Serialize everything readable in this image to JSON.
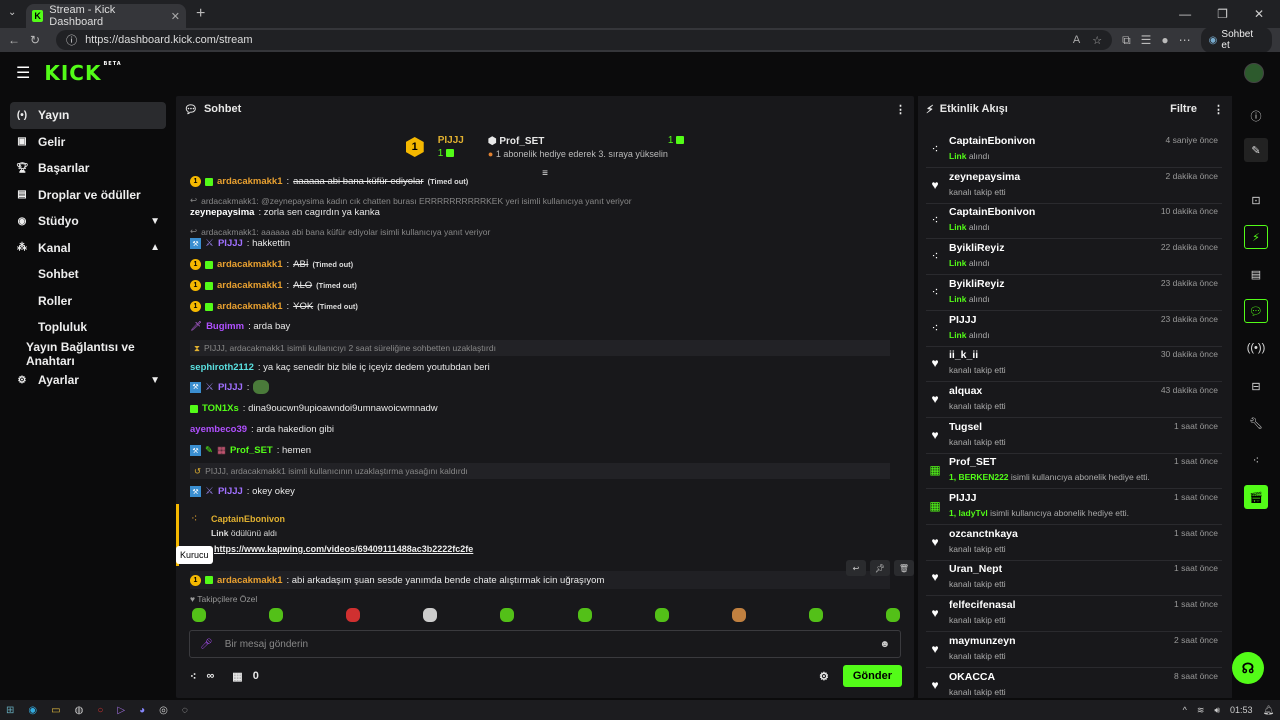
{
  "browser": {
    "tab_title": "Stream - Kick Dashboard",
    "url": "https://dashboard.kick.com/stream",
    "chat_button": "Sohbet et"
  },
  "app": {
    "logo": "KICK",
    "beta": "BETA"
  },
  "sidebar": {
    "items": [
      {
        "label": "Yayın",
        "icon": "broadcast-icon"
      },
      {
        "label": "Gelir",
        "icon": "revenue-icon"
      },
      {
        "label": "Başarılar",
        "icon": "trophy-icon"
      },
      {
        "label": "Droplar ve ödüller",
        "icon": "gift-icon"
      },
      {
        "label": "Stüdyo",
        "icon": "studio-icon"
      },
      {
        "label": "Kanal",
        "icon": "channel-icon"
      },
      {
        "label": "Sohbet"
      },
      {
        "label": "Roller"
      },
      {
        "label": "Topluluk"
      },
      {
        "label": "Yayın Bağlantısı ve Anahtarı"
      },
      {
        "label": "Ayarlar",
        "icon": "gear-icon"
      }
    ]
  },
  "chat": {
    "title": "Sohbet",
    "pinned": {
      "user1": "PIJJJ",
      "count1": "1",
      "badge": "1",
      "user2": "Prof_SET",
      "count2": "1",
      "text": "1 abonelik hediye ederek 3. sıraya yükselin"
    },
    "messages": [
      {
        "user": "ardacakmakk1",
        "text": "aaaaaa abi bana küfür ediyolar",
        "tag": "(Timed out)"
      },
      {
        "reply": "ardacakmakk1: @zeynepaysima kadın cık chatten burası ERRRRRRRRRRKEK yeri isimli kullanıcıya yanıt veriyor"
      },
      {
        "user": "zeynepaysima",
        "text": ": zorla sen cagırdın ya kanka"
      },
      {
        "reply": "ardacakmakk1: aaaaaa abi bana küfür ediyolar isimli kullanıcıya yanıt veriyor"
      },
      {
        "user": "PIJJJ",
        "text": ": hakkettin"
      },
      {
        "user": "ardacakmakk1",
        "text": "ABİ",
        "tag": "(Timed out)"
      },
      {
        "user": "ardacakmakk1",
        "text": "ALO",
        "tag": "(Timed out)"
      },
      {
        "user": "ardacakmakk1",
        "text": "YOK",
        "tag": "(Timed out)"
      },
      {
        "user": "Bugimm",
        "text": ": arda bay"
      },
      {
        "system": "PIJJJ, ardacakmakk1 isimli kullanıcıyı 2 saat süreliğine sohbetten uzaklaştırdı"
      },
      {
        "user": "sephiroth2112",
        "text": ": ya kaç senedir biz bile iç içeyiz dedem youtubdan beri"
      },
      {
        "user": "PIJJJ",
        "text": ":"
      },
      {
        "user": "TON1Xs",
        "text": ": dina9oucwn9upioawndoi9umnawoicwmnadw"
      },
      {
        "user": "ayembeco39",
        "text": ": arda hakedion gibi"
      },
      {
        "user": "Prof_SET",
        "text": ": hemen"
      },
      {
        "system": "PIJJJ, ardacakmakk1 isimli kullanıcının uzaklaştırma yasağını kaldırdı"
      },
      {
        "user": "PIJJJ",
        "text": ": okey okey"
      },
      {
        "user": "ardacakmakk1",
        "text": ": abi arkadaşım şuan sesde yanımda bende chate alıştırmak icin uğraşıyom"
      }
    ],
    "highlight": {
      "name": "CaptainEbonivon",
      "desc_bold": "Link",
      "desc": " ödülünü aldı",
      "link": "https://www.kapwing.com/videos/69409111488ac3b2222fc2fe"
    },
    "tooltip": "Kurucu",
    "followers_only": "Takipçilere Özel",
    "input_placeholder": "Bir mesaj gönderin",
    "viewers_symbol": "∞",
    "gift_count": "0",
    "send_label": "Gönder"
  },
  "feed": {
    "title": "Etkinlik Akışı",
    "filter": "Filtre",
    "items": [
      {
        "name": "CaptainEbonivon",
        "bold": "Link",
        "desc": " alındı",
        "time": "4 saniye önce",
        "icon": "reward-icon"
      },
      {
        "name": "zeynepaysima",
        "bold": "",
        "desc": "kanalı takip etti",
        "time": "2 dakika önce",
        "icon": "heart-icon"
      },
      {
        "name": "CaptainEbonivon",
        "bold": "Link",
        "desc": " alındı",
        "time": "10 dakika önce",
        "icon": "reward-icon"
      },
      {
        "name": "ByikliReyiz",
        "bold": "Link",
        "desc": " alındı",
        "time": "22 dakika önce",
        "icon": "reward-icon"
      },
      {
        "name": "ByikliReyiz",
        "bold": "Link",
        "desc": " alındı",
        "time": "23 dakika önce",
        "icon": "reward-icon"
      },
      {
        "name": "PIJJJ",
        "bold": "Link",
        "desc": " alındı",
        "time": "23 dakika önce",
        "icon": "reward-icon"
      },
      {
        "name": "ii_k_ii",
        "bold": "",
        "desc": "kanalı takip etti",
        "time": "30 dakika önce",
        "icon": "heart-icon"
      },
      {
        "name": "alquax",
        "bold": "",
        "desc": "kanalı takip etti",
        "time": "43 dakika önce",
        "icon": "heart-icon"
      },
      {
        "name": "Tugsel",
        "bold": "",
        "desc": "kanalı takip etti",
        "time": "1 saat önce",
        "icon": "heart-icon"
      },
      {
        "name": "Prof_SET",
        "bold": "1, BERKEN222",
        "desc": " isimli kullanıcıya abonelik hediye etti.",
        "time": "1 saat önce",
        "icon": "gift-sub-icon"
      },
      {
        "name": "PIJJJ",
        "bold": "1, ladyTvl",
        "desc": " isimli kullanıcıya abonelik hediye etti.",
        "time": "1 saat önce",
        "icon": "gift-sub-icon"
      },
      {
        "name": "ozcanctnkaya",
        "bold": "",
        "desc": "kanalı takip etti",
        "time": "1 saat önce",
        "icon": "heart-icon"
      },
      {
        "name": "Uran_Nept",
        "bold": "",
        "desc": "kanalı takip etti",
        "time": "1 saat önce",
        "icon": "heart-icon"
      },
      {
        "name": "felfecifenasal",
        "bold": "",
        "desc": "kanalı takip etti",
        "time": "1 saat önce",
        "icon": "heart-icon"
      },
      {
        "name": "maymunzeyn",
        "bold": "",
        "desc": "kanalı takip etti",
        "time": "2 saat önce",
        "icon": "heart-icon"
      },
      {
        "name": "OKACCA",
        "bold": "",
        "desc": "kanalı takip etti",
        "time": "8 saat önce",
        "icon": "heart-icon"
      }
    ]
  },
  "taskbar": {
    "time": "01:53"
  },
  "colors": {
    "accent": "#53fc18",
    "gold": "#f5b800",
    "panel": "#18181b"
  }
}
